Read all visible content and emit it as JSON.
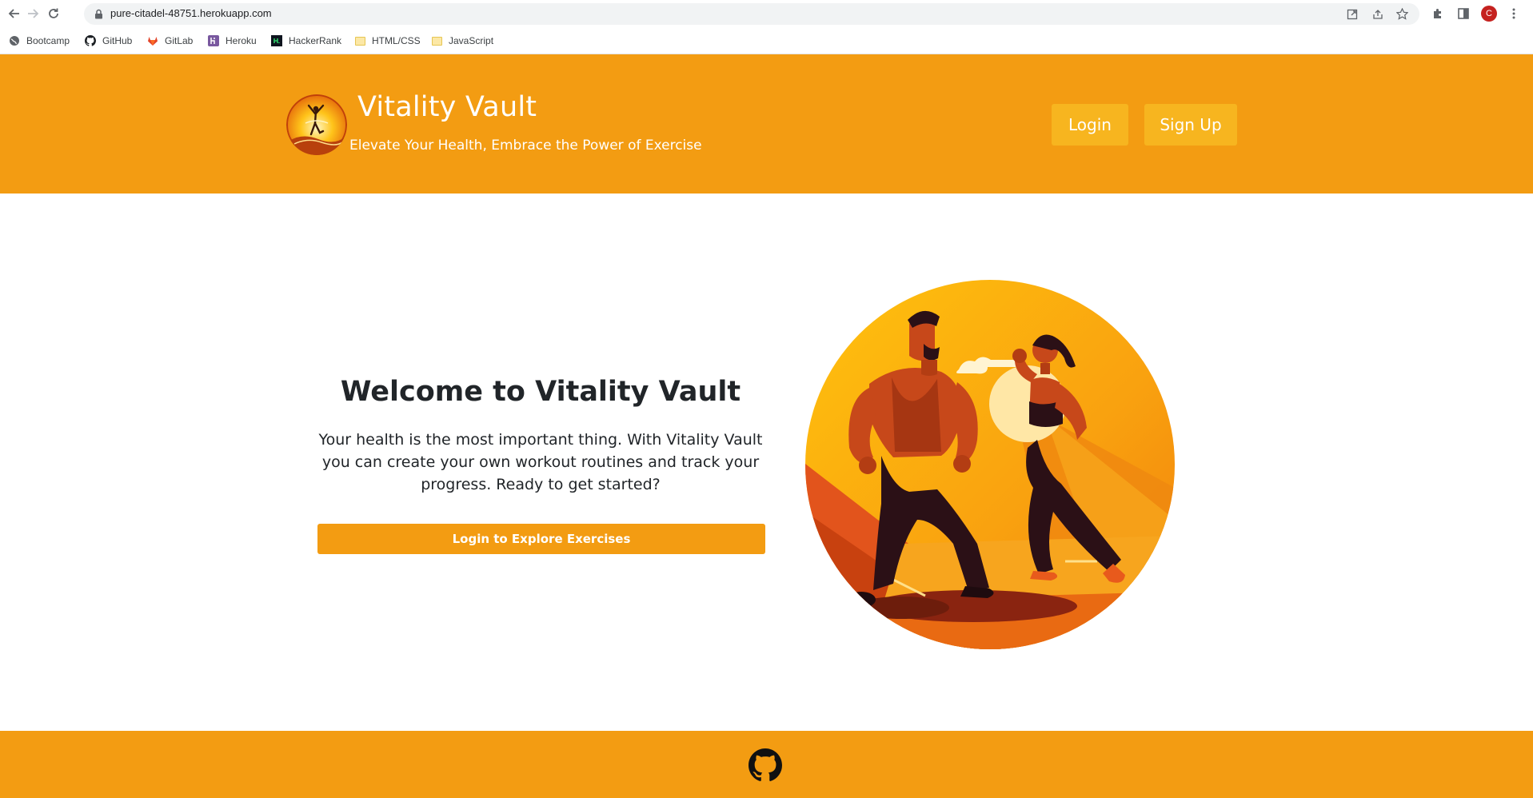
{
  "browser": {
    "url": "pure-citadel-48751.herokuapp.com",
    "profile_initial": "C",
    "bookmarks": [
      {
        "label": "Bootcamp",
        "icon": "globe-icon"
      },
      {
        "label": "GitHub",
        "icon": "github-icon"
      },
      {
        "label": "GitLab",
        "icon": "gitlab-icon"
      },
      {
        "label": "Heroku",
        "icon": "heroku-icon"
      },
      {
        "label": "HackerRank",
        "icon": "hackerrank-icon"
      },
      {
        "label": "HTML/CSS",
        "icon": "folder-icon"
      },
      {
        "label": "JavaScript",
        "icon": "folder-icon"
      }
    ]
  },
  "header": {
    "title": "Vitality Vault",
    "tagline": "Elevate Your Health, Embrace the Power of Exercise",
    "login_label": "Login",
    "signup_label": "Sign Up"
  },
  "hero": {
    "title": "Welcome to Vitality Vault",
    "text": "Your health is the most important thing. With Vitality Vault you can create your own workout routines and track your progress. Ready to get started?",
    "cta_label": "Login to Explore Exercises"
  },
  "footer": {
    "icon": "github-icon"
  },
  "colors": {
    "brand": "#f39c12",
    "button": "#f7b51f",
    "text": "#212529"
  }
}
